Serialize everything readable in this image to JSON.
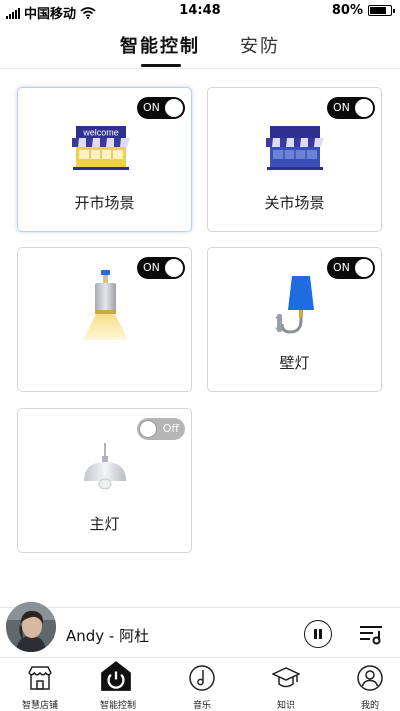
{
  "status_bar": {
    "carrier": "中国移动",
    "time": "14:48",
    "battery": "80%",
    "battery_level": 0.8
  },
  "top_tabs": [
    {
      "label": "智能控制",
      "active": true
    },
    {
      "label": "安防",
      "active": false
    }
  ],
  "devices": [
    {
      "label": "开市场景",
      "toggle": "ON",
      "on": true,
      "icon": "store-open-icon",
      "sign_text": "welcome"
    },
    {
      "label": "关市场景",
      "toggle": "ON",
      "on": true,
      "icon": "store-closed-icon"
    },
    {
      "label": "",
      "toggle": "ON",
      "on": true,
      "icon": "spotlight-icon"
    },
    {
      "label": "壁灯",
      "toggle": "ON",
      "on": true,
      "icon": "wall-lamp-icon"
    },
    {
      "label": "主灯",
      "toggle": "Off",
      "on": false,
      "icon": "pendant-lamp-icon"
    }
  ],
  "player": {
    "track": "Andy - 阿杜",
    "state": "playing"
  },
  "bottom_nav": [
    {
      "label": "智慧店铺",
      "icon": "storefront-icon",
      "active": false
    },
    {
      "label": "智能控制",
      "icon": "power-icon",
      "active": true
    },
    {
      "label": "音乐",
      "icon": "music-note-icon",
      "active": false
    },
    {
      "label": "知识",
      "icon": "graduation-cap-icon",
      "active": false
    },
    {
      "label": "我的",
      "icon": "user-icon",
      "active": false
    }
  ],
  "colors": {
    "toggle_on": "#0a0a0a",
    "toggle_off": "#b5b5b5",
    "store_roof": "#2e2f8f",
    "lamp_blue": "#1f6be0"
  }
}
